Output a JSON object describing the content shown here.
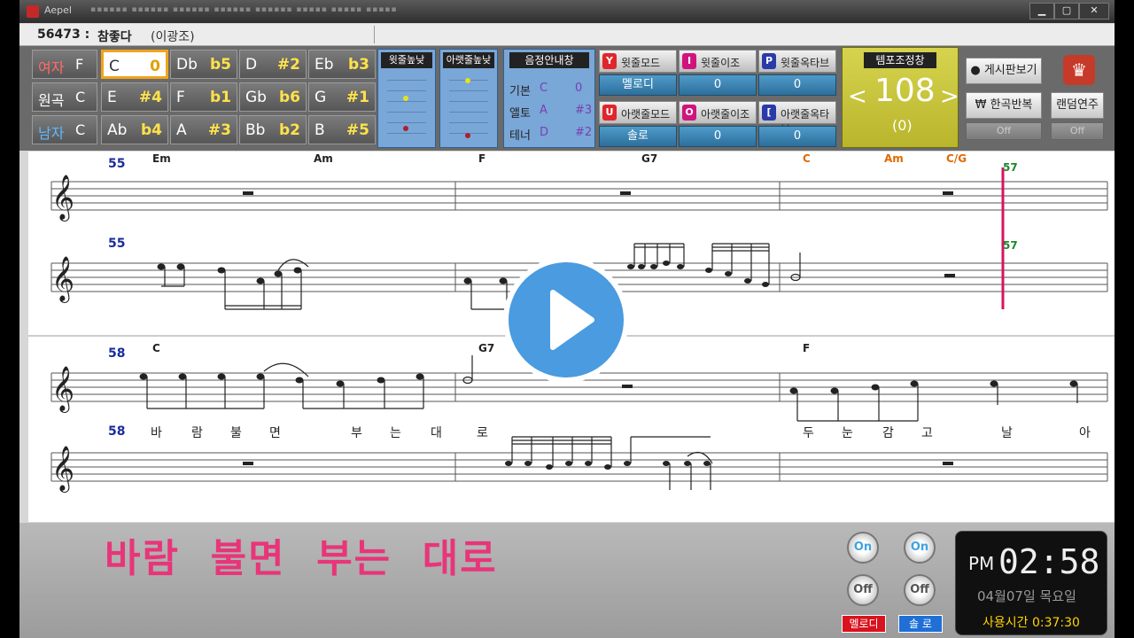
{
  "window": {
    "title": "Aepel",
    "menus": "▪▪▪▪▪▪  ▪▪▪▪▪▪  ▪▪▪▪▪▪  ▪▪▪▪▪▪  ▪▪▪▪▪▪  ▪▪▪▪▪  ▪▪▪▪▪  ▪▪▪▪▪",
    "buttons": [
      "▁",
      "▢",
      "✕"
    ]
  },
  "song": {
    "number": "56473 :",
    "title": "참좋다",
    "artist": "(이광조)"
  },
  "key_grid": {
    "rows": [
      {
        "label": "여자",
        "label_key": "F",
        "label_color": "#ff6b6b",
        "cells": [
          {
            "k": "C",
            "v": "0",
            "selected": true
          },
          {
            "k": "Db",
            "v": "b5"
          },
          {
            "k": "D",
            "v": "#2"
          },
          {
            "k": "Eb",
            "v": "b3"
          }
        ]
      },
      {
        "label": "원곡",
        "label_key": "C",
        "label_color": "#ffffff",
        "cells": [
          {
            "k": "E",
            "v": "#4"
          },
          {
            "k": "F",
            "v": "b1"
          },
          {
            "k": "Gb",
            "v": "b6"
          },
          {
            "k": "G",
            "v": "#1"
          }
        ]
      },
      {
        "label": "남자",
        "label_key": "C",
        "label_color": "#5fb8ff",
        "cells": [
          {
            "k": "Ab",
            "v": "b4"
          },
          {
            "k": "A",
            "v": "#3"
          },
          {
            "k": "Bb",
            "v": "b2"
          },
          {
            "k": "B",
            "v": "#5"
          }
        ]
      }
    ]
  },
  "pitch": {
    "upper": "윗줄높낮",
    "lower": "아랫줄높낮"
  },
  "guide": {
    "title": "음정안내창",
    "rows": [
      [
        "기본",
        "C",
        "0"
      ],
      [
        "앨토",
        "A",
        "#3"
      ],
      [
        "테너",
        "D",
        "#2"
      ]
    ]
  },
  "modes": [
    {
      "icon": "Y",
      "icon_color": "#e0252b",
      "label": "윗줄모드",
      "value": "멜로디"
    },
    {
      "icon": "I",
      "icon_color": "#d0147d",
      "label": "윗줄이조",
      "value": "0"
    },
    {
      "icon": "P",
      "icon_color": "#2a3aa8",
      "label": "윗줄옥타브",
      "value": "0"
    },
    {
      "icon": "U",
      "icon_color": "#e0252b",
      "label": "아랫줄모드",
      "value": "솔로"
    },
    {
      "icon": "O",
      "icon_color": "#d0147d",
      "label": "아랫줄이조",
      "value": "0"
    },
    {
      "icon": "[",
      "icon_color": "#2a3aa8",
      "label": "아랫줄옥타브",
      "value": "0"
    }
  ],
  "tempo": {
    "title": "템포조정창",
    "value": "108",
    "offset": "(0)",
    "left": "<",
    "right": ">"
  },
  "right_buttons": {
    "board": "● 게시판보기",
    "repeat": "₩ 한곡반복",
    "random": "랜덤연주",
    "repeat_state": "Off",
    "random_state": "Off"
  },
  "score": {
    "system1": {
      "measure": "55",
      "chords": [
        "Em",
        "Am",
        "F",
        "G7",
        "C",
        "Am",
        "C/G"
      ],
      "cursor_measure": "57"
    },
    "system2": {
      "measure": "58",
      "chords": [
        "C",
        "G7",
        "F"
      ],
      "lyrics": [
        "바",
        "람",
        "불",
        "면",
        "부",
        "는",
        "대",
        "로",
        "두",
        "눈",
        "감",
        "고",
        "날",
        "아"
      ]
    }
  },
  "bottom": {
    "lyrics": "바람  불면  부는  대로",
    "on_label": "On",
    "off_label": "Off",
    "melody_tag": "멜로디",
    "solo_tag": "솔 로"
  },
  "clock": {
    "ampm": "PM",
    "time": "02:58",
    "date": "04월07일 목요일",
    "usage": "사용시간 0:37:30"
  },
  "colors": {
    "lyric": "#e8357a",
    "measure_num": "#1a2c9c",
    "cursor": "#d6145f",
    "chord_orange": "#e06a00"
  }
}
